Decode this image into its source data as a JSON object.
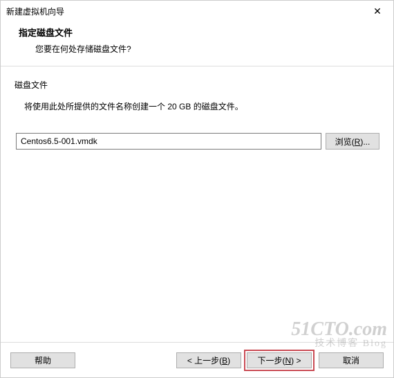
{
  "window": {
    "title": "新建虚拟机向导",
    "close": "✕"
  },
  "header": {
    "title": "指定磁盘文件",
    "subtitle": "您要在何处存储磁盘文件?"
  },
  "content": {
    "section_label": "磁盘文件",
    "description": "将使用此处所提供的文件名称创建一个 20 GB 的磁盘文件。",
    "file_value": "Centos6.5-001.vmdk",
    "browse_label": "浏览(R)..."
  },
  "footer": {
    "help": "帮助",
    "back": "< 上一步(B)",
    "next": "下一步(N) >",
    "cancel": "取消"
  },
  "watermark": {
    "line1": "51CTO.com",
    "line2": "技术博客 Blog"
  }
}
